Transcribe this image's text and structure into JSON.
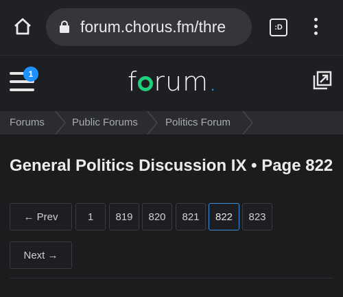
{
  "browser": {
    "url_text": "forum.chorus.fm/thre",
    "tab_icon_label": ":D"
  },
  "header": {
    "notification_count": "1",
    "logo": {
      "pre": "f",
      "post": "rum",
      "period": "."
    }
  },
  "breadcrumb": {
    "items": [
      "Forums",
      "Public Forums",
      "Politics Forum"
    ]
  },
  "thread": {
    "title": "General Politics Discussion IX • Page 822"
  },
  "pagination": {
    "prev_label": "← Prev",
    "next_label": "Next →",
    "pages": [
      "1",
      "819",
      "820",
      "821",
      "822",
      "823"
    ],
    "current_page": "822"
  },
  "colors": {
    "accent": "#3a8fd6",
    "logo_ring": "#1cd17a",
    "badge": "#1e90ff"
  }
}
